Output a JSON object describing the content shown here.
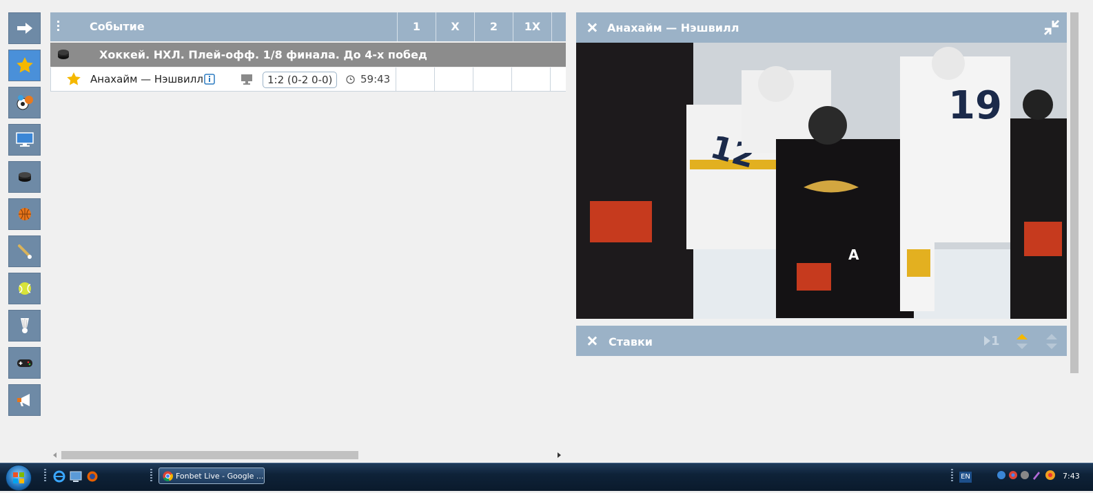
{
  "table": {
    "header_title": "Событие",
    "columns": [
      "1",
      "X",
      "2",
      "1X"
    ],
    "league": "Хоккей. НХЛ. Плей-офф. 1/8 финала. До 4-х побед",
    "event": {
      "name": "Анахайм — Нэшвилл",
      "score": "1:2 (0-2 0-0)",
      "time": "59:43"
    }
  },
  "video_panel": {
    "title": "Анахайм — Нэшвилл"
  },
  "bets_panel": {
    "title": "Ставки",
    "counter": "1"
  },
  "sidebar": {
    "items": [
      "arrow-right-icon",
      "star-icon",
      "all-sports-icon",
      "monitor-icon",
      "hockey-puck-icon",
      "basketball-icon",
      "baseball-icon",
      "tennis-ball-icon",
      "badminton-icon",
      "gamepad-icon",
      "megaphone-icon"
    ]
  },
  "taskbar": {
    "language": "EN",
    "active_window": "Fonbet Live - Google ...",
    "clock": "7:43"
  },
  "colors": {
    "header_bg": "#9bb2c7",
    "league_bg": "#8c8c8c",
    "sidebar_bg": "#6e8aa6",
    "sidebar_active": "#4a90d9",
    "star": "#f5b800"
  }
}
